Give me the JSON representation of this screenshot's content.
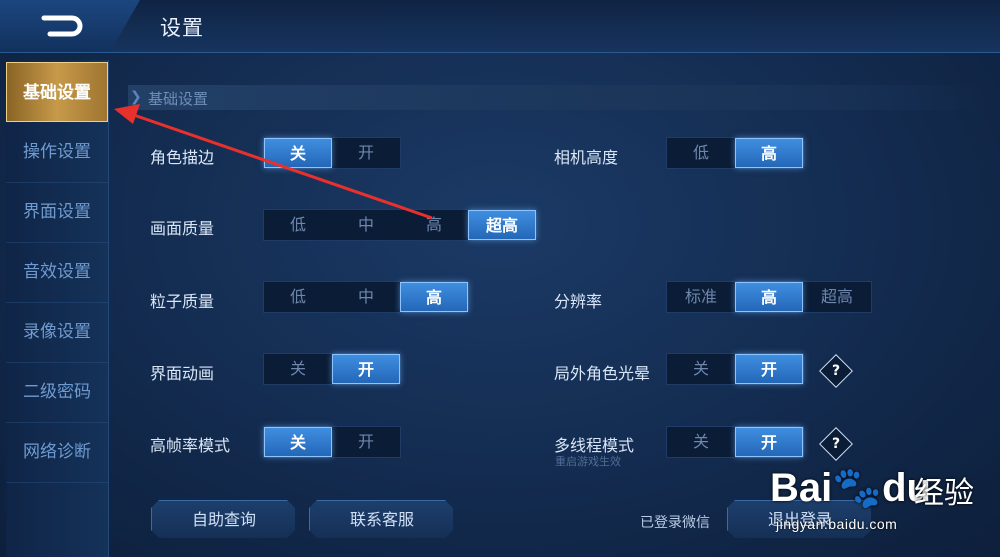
{
  "header": {
    "title": "设置",
    "back_icon": "back-arrow-icon"
  },
  "sidebar": {
    "items": [
      {
        "label": "基础设置",
        "active": true
      },
      {
        "label": "操作设置"
      },
      {
        "label": "界面设置"
      },
      {
        "label": "音效设置"
      },
      {
        "label": "录像设置"
      },
      {
        "label": "二级密码"
      },
      {
        "label": "网络诊断"
      }
    ]
  },
  "section": {
    "title": "基础设置"
  },
  "settings": {
    "outline": {
      "label": "角色描边",
      "options": [
        "关",
        "开"
      ],
      "selected": "关"
    },
    "camera_height": {
      "label": "相机高度",
      "options": [
        "低",
        "高"
      ],
      "selected": "高"
    },
    "graphics_quality": {
      "label": "画面质量",
      "options": [
        "低",
        "中",
        "高",
        "超高"
      ],
      "selected": "超高"
    },
    "particle_quality": {
      "label": "粒子质量",
      "options": [
        "低",
        "中",
        "高"
      ],
      "selected": "高"
    },
    "resolution": {
      "label": "分辨率",
      "options": [
        "标准",
        "高",
        "超高"
      ],
      "selected": "高"
    },
    "ui_animation": {
      "label": "界面动画",
      "options": [
        "关",
        "开"
      ],
      "selected": "开"
    },
    "outer_halo": {
      "label": "局外角色光晕",
      "options": [
        "关",
        "开"
      ],
      "selected": "开",
      "help": "?"
    },
    "high_fps": {
      "label": "高帧率模式",
      "options": [
        "关",
        "开"
      ],
      "selected": "关"
    },
    "multithread": {
      "label": "多线程模式",
      "options": [
        "关",
        "开"
      ],
      "selected": "开",
      "help": "?",
      "note": "重启游戏生效"
    }
  },
  "footer": {
    "self_query": "自助查询",
    "contact_service": "联系客服",
    "login_status": "已登录微信",
    "logout": "退出登录"
  },
  "watermark": {
    "brand": "Bai",
    "brand_tail": "du",
    "cn": "经验",
    "url": "jingyan.baidu.com"
  },
  "colors": {
    "accent_gold": "#c79a4a",
    "toggle_on": "#2f7ad0",
    "annotation_arrow": "#e8302c"
  }
}
